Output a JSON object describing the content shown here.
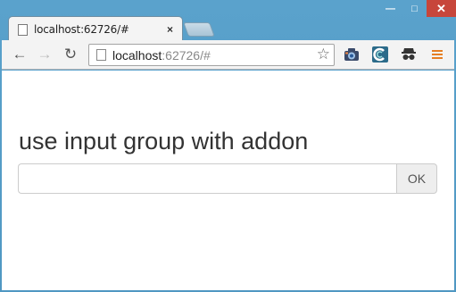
{
  "browser": {
    "tab": {
      "title": "localhost:62726/#",
      "close_glyph": "×"
    },
    "window_controls": {
      "minimize_glyph": "—",
      "maximize_glyph": "□",
      "close_glyph": "✕"
    },
    "nav": {
      "back_glyph": "←",
      "forward_glyph": "→",
      "reload_glyph": "↻"
    },
    "address": {
      "host": "localhost",
      "rest": ":62726/#",
      "bookmark_glyph": "☆"
    },
    "extensions": [
      "camera-extension-icon",
      "c-extension-icon",
      "incognito-mask-icon",
      "menu-icon"
    ]
  },
  "page": {
    "heading": "use input group with addon",
    "input": {
      "value": "",
      "placeholder": ""
    },
    "addon_label": "OK"
  },
  "colors": {
    "frame": "#5aa2cc",
    "close_button": "#c7463b",
    "addon_bg": "#eeeeee",
    "heading_text": "#333333"
  }
}
